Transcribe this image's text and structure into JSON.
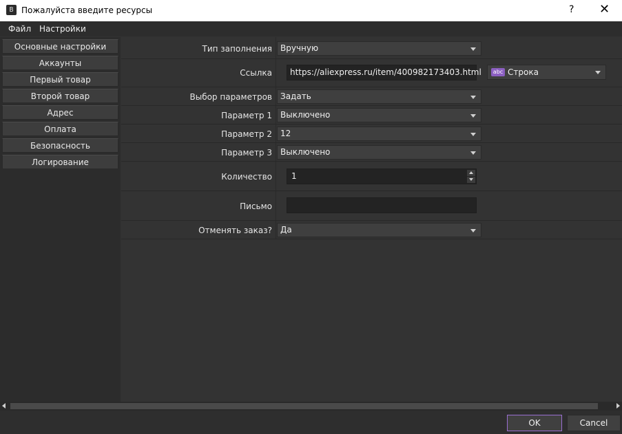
{
  "window": {
    "title": "Пожалуйста введите ресурсы",
    "help": "?",
    "close": "✕",
    "icon_glyph": "B"
  },
  "menu": {
    "items": [
      "Файл",
      "Настройки"
    ]
  },
  "sidebar": {
    "items": [
      "Основные настройки",
      "Аккаунты",
      "Первый товар",
      "Второй товар",
      "Адрес",
      "Оплата",
      "Безопасность",
      "Логирование"
    ]
  },
  "form": {
    "fill_type": {
      "label": "Тип заполнения",
      "value": "Вручную"
    },
    "link": {
      "label": "Ссылка",
      "value": "https://aliexpress.ru/item/400982173403.html",
      "type_icon": "abc",
      "type_value": "Строка"
    },
    "param_choice": {
      "label": "Выбор параметров",
      "value": "Задать"
    },
    "param1": {
      "label": "Параметр 1",
      "value": "Выключено"
    },
    "param2": {
      "label": "Параметр 2",
      "value": "12"
    },
    "param3": {
      "label": "Параметр 3",
      "value": "Выключено"
    },
    "quantity": {
      "label": "Количество",
      "value": "1"
    },
    "letter": {
      "label": "Письмо",
      "value": ""
    },
    "cancel_order": {
      "label": "Отменять заказ?",
      "value": "Да"
    }
  },
  "footer": {
    "ok": "OK",
    "cancel": "Cancel"
  },
  "colors": {
    "accent": "#9b6fd3",
    "background": "#323232"
  }
}
